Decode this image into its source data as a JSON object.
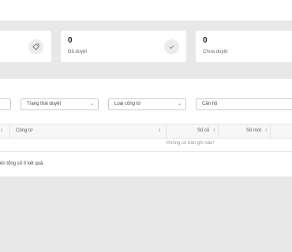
{
  "stats": [
    {
      "value": "",
      "label": "",
      "icon": "tag-icon"
    },
    {
      "value": "0",
      "label": "Đã duyệt",
      "icon": "check-icon"
    },
    {
      "value": "0",
      "label": "Chưa duyệt",
      "icon": ""
    }
  ],
  "filters": {
    "status": "Trạng thái duyệt",
    "meter_type": "Loại công tơ",
    "apartment": "Căn hộ"
  },
  "table": {
    "columns": [
      "Công tơ",
      "Số cũ",
      "Số mới"
    ],
    "empty_text": "Không có bản ghi nào!"
  },
  "summary": "ên tổng số 0 kết quả"
}
